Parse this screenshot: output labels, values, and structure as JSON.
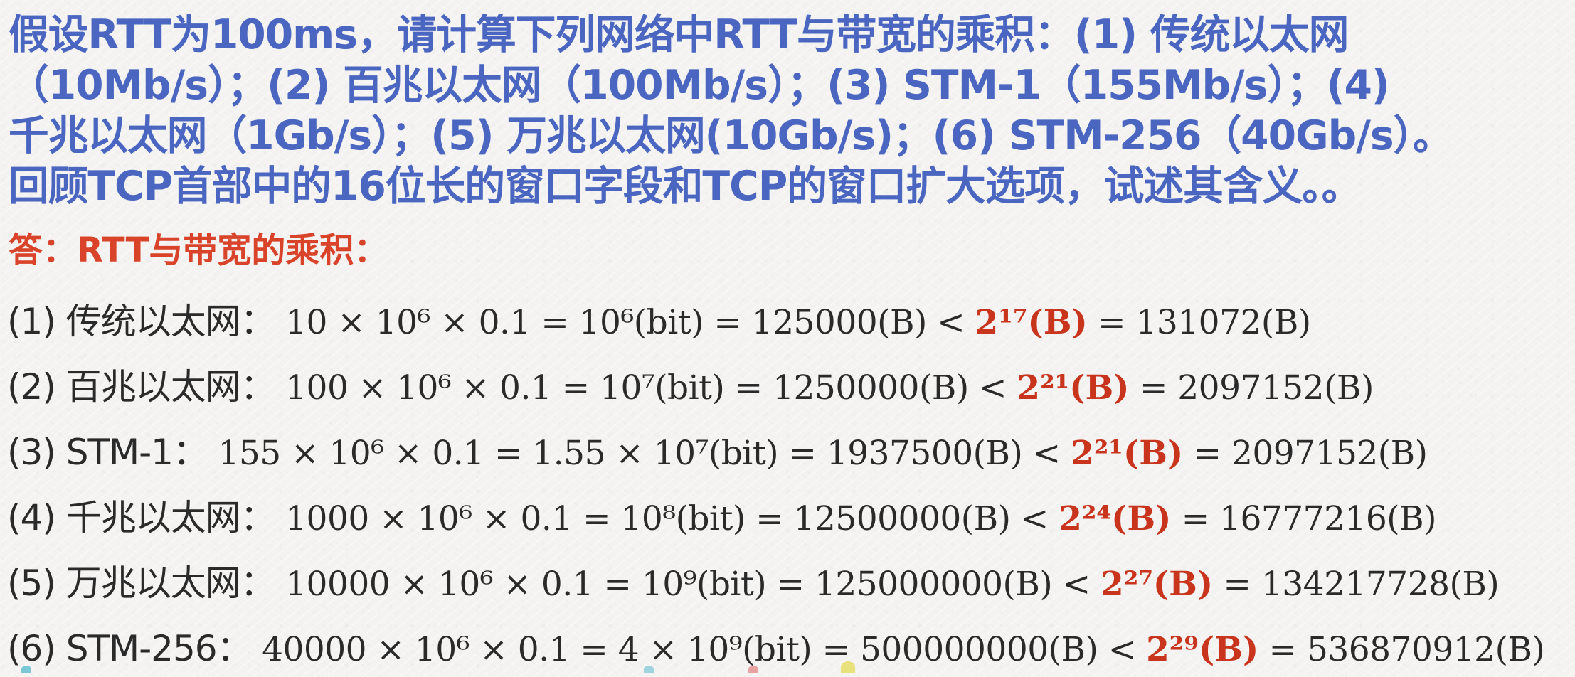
{
  "question": {
    "lines": [
      "假设RTT为100ms，请计算下列网络中RTT与带宽的乘积：(1) 传统以太网",
      "（10Mb/s）；(2) 百兆以太网（100Mb/s）；(3) STM-1（155Mb/s）；(4)",
      "千兆以太网（1Gb/s）；(5) 万兆以太网(10Gb/s)；(6) STM-256（40Gb/s）。",
      "回顾TCP首部中的16位长的窗口字段和TCP的窗口扩大选项，试述其含义。。"
    ]
  },
  "answer": {
    "heading": "答：RTT与带宽的乘积："
  },
  "rows": [
    {
      "label": "(1) 传统以太网：",
      "formula": " 10 × 10⁶ × 0.1 = 10⁶(bit) = 125000(B) < ",
      "highlight": "2¹⁷(B)",
      "tail": " = 131072(B)"
    },
    {
      "label": "(2) 百兆以太网：",
      "formula": "  100 × 10⁶ × 0.1 = 10⁷(bit) = 1250000(B) < ",
      "highlight": "2²¹(B)",
      "tail": " = 2097152(B)"
    },
    {
      "label": "(3) STM-1：",
      "formula": "  155 × 10⁶ × 0.1 = 1.55 × 10⁷(bit) = 1937500(B) < ",
      "highlight": "2²¹(B)",
      "tail": " = 2097152(B)"
    },
    {
      "label": "(4) 千兆以太网：",
      "formula": " 1000 × 10⁶ × 0.1 = 10⁸(bit) = 12500000(B) < ",
      "highlight": "2²⁴(B)",
      "tail": " = 16777216(B)"
    },
    {
      "label": "(5) 万兆以太网：",
      "formula": "  10000 × 10⁶ × 0.1 = 10⁹(bit) = 125000000(B) < ",
      "highlight": "2²⁷(B)",
      "tail": " = 134217728(B)"
    },
    {
      "label": "(6) STM-256：",
      "formula": "  40000 × 10⁶ × 0.1 = 4 × 10⁹(bit) = 500000000(B) < ",
      "highlight": "2²⁹(B)",
      "tail": " = 536870912(B)"
    }
  ],
  "colors": {
    "question": "#4a66c0",
    "heading": "#d8432a",
    "highlight": "#c8341c",
    "body": "#2a2a2a"
  }
}
